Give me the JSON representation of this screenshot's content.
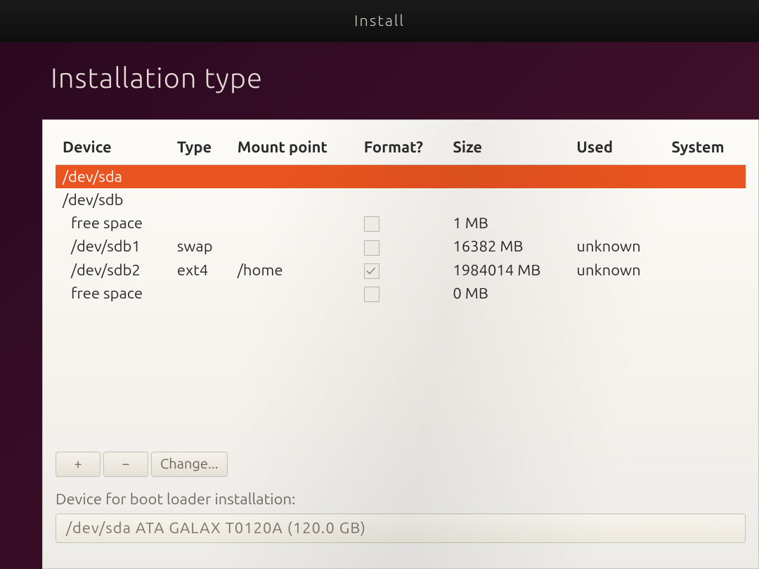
{
  "window_title": "Install",
  "page_heading": "Installation type",
  "columns": {
    "device": "Device",
    "type": "Type",
    "mount": "Mount point",
    "format": "Format?",
    "size": "Size",
    "used": "Used",
    "system": "System"
  },
  "rows": [
    {
      "device": "/dev/sda",
      "type": "",
      "mount": "",
      "format": null,
      "size": "",
      "used": "",
      "system": "",
      "selected": true,
      "indent": false
    },
    {
      "device": "/dev/sdb",
      "type": "",
      "mount": "",
      "format": null,
      "size": "",
      "used": "",
      "system": "",
      "selected": false,
      "indent": false
    },
    {
      "device": "free space",
      "type": "",
      "mount": "",
      "format": false,
      "size": "1 MB",
      "used": "",
      "system": "",
      "selected": false,
      "indent": true
    },
    {
      "device": "/dev/sdb1",
      "type": "swap",
      "mount": "",
      "format": false,
      "size": "16382 MB",
      "used": "unknown",
      "system": "",
      "selected": false,
      "indent": true
    },
    {
      "device": "/dev/sdb2",
      "type": "ext4",
      "mount": "/home",
      "format": true,
      "size": "1984014 MB",
      "used": "unknown",
      "system": "",
      "selected": false,
      "indent": true
    },
    {
      "device": "free space",
      "type": "",
      "mount": "",
      "format": false,
      "size": "0 MB",
      "used": "",
      "system": "",
      "selected": false,
      "indent": true
    }
  ],
  "toolbar": {
    "add": "+",
    "remove": "−",
    "change": "Change..."
  },
  "bootloader": {
    "label": "Device for boot loader installation:",
    "value": "/dev/sda   ATA GALAX T0120A (120.0 GB)"
  }
}
